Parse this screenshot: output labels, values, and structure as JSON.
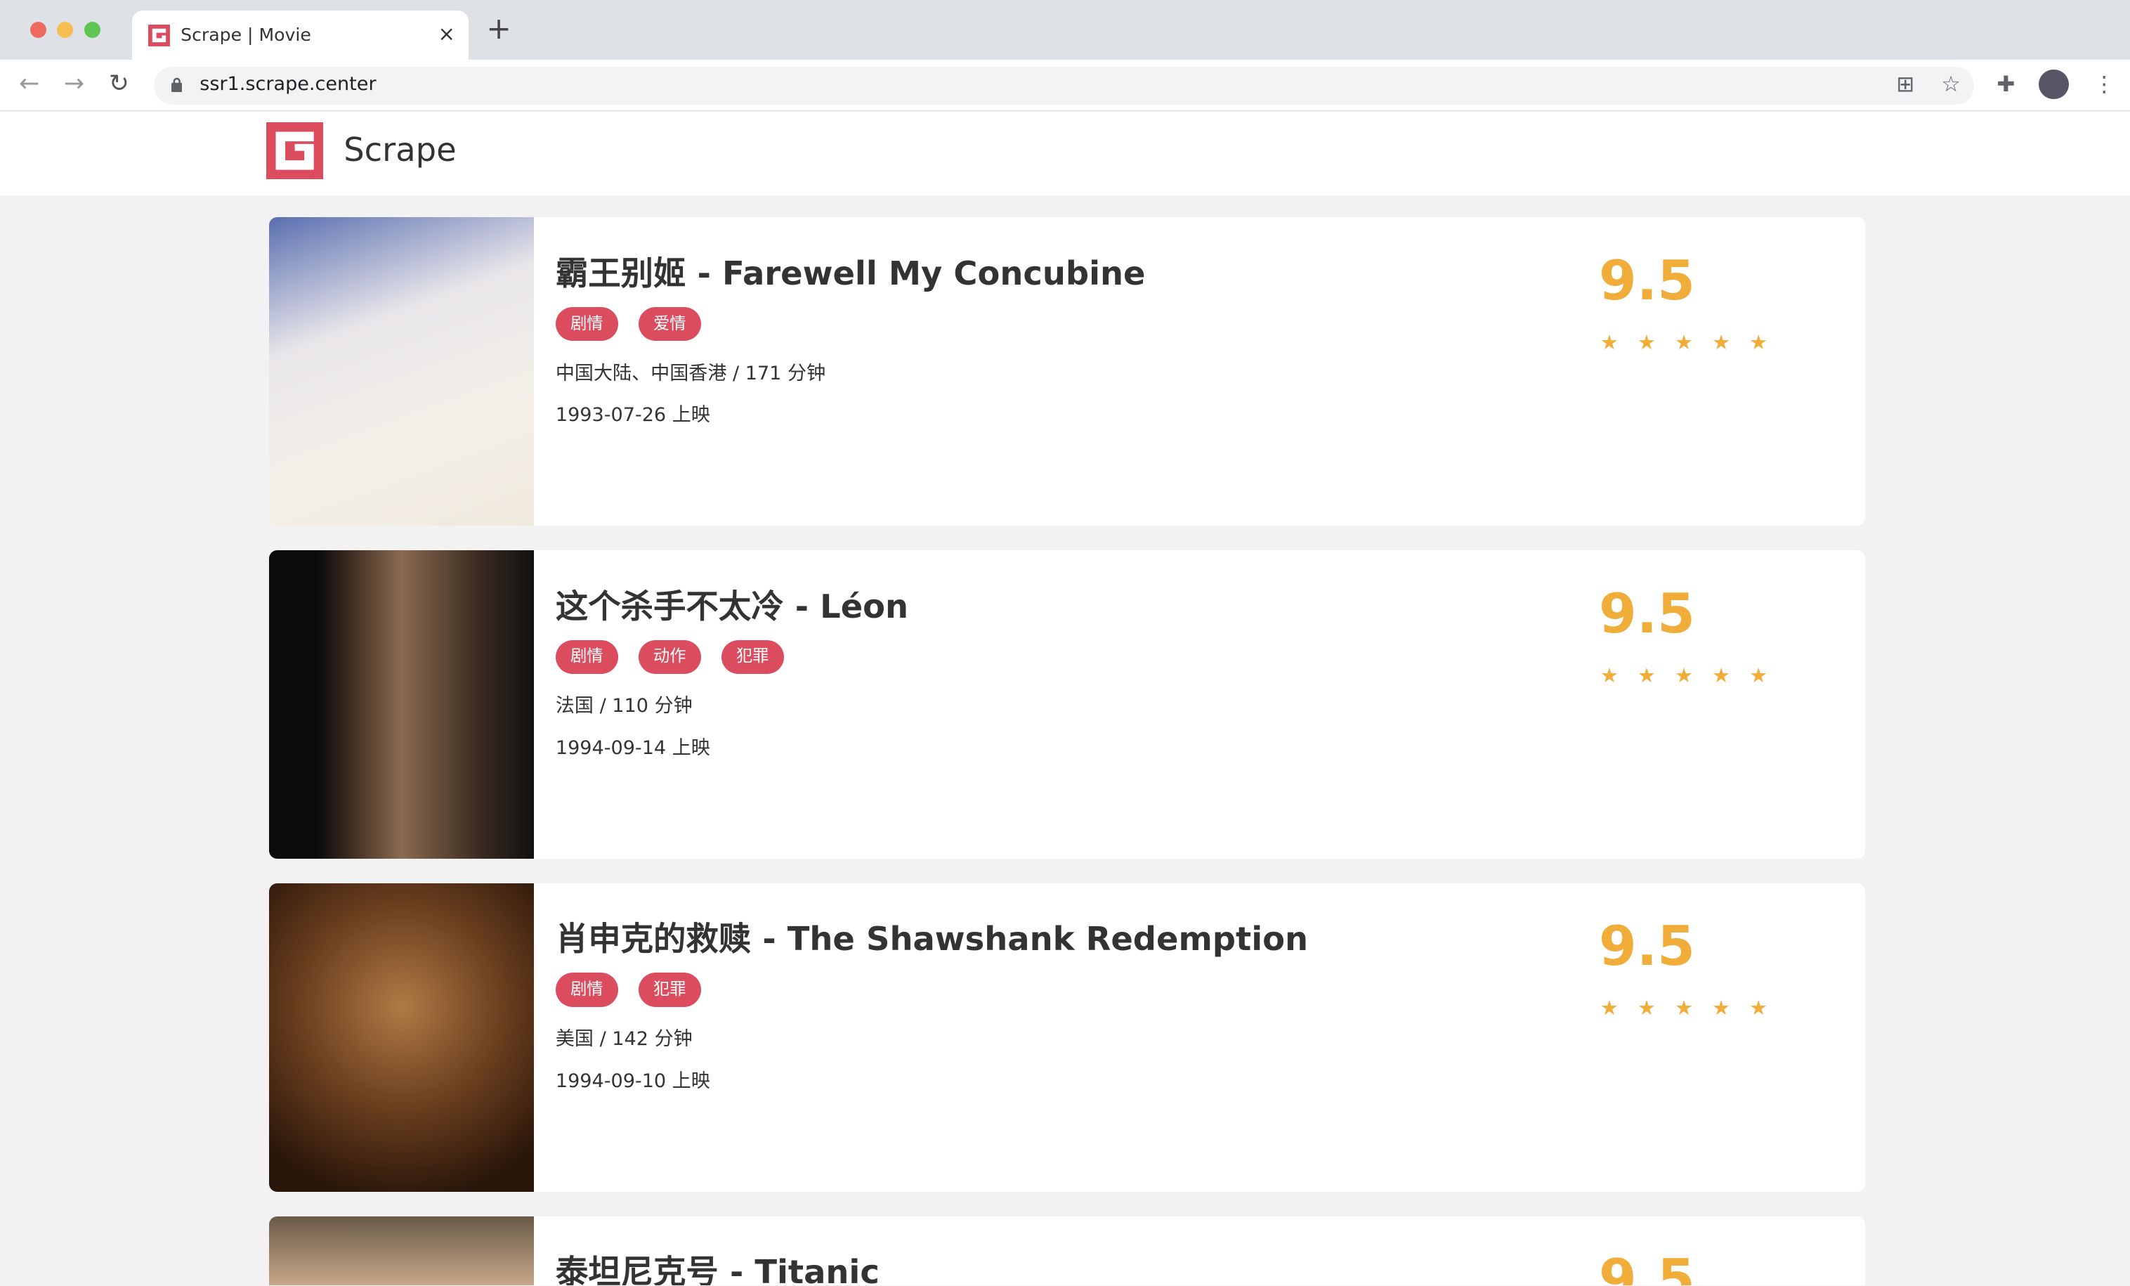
{
  "browser": {
    "tab_title": "Scrape | Movie",
    "url": "ssr1.scrape.center",
    "new_tab": "+",
    "close": "×"
  },
  "site": {
    "brand": "Scrape",
    "accent": "#db4c5f",
    "score_color": "#f0ad3a"
  },
  "movies": [
    {
      "title": "霸王别姬 - Farewell My Concubine",
      "tags": [
        "剧情",
        "爱情"
      ],
      "info": "中国大陆、中国香港 / 171 分钟",
      "release": "1993-07-26 上映",
      "score": "9.5",
      "stars": 5
    },
    {
      "title": "这个杀手不太冷 - Léon",
      "tags": [
        "剧情",
        "动作",
        "犯罪"
      ],
      "info": "法国 / 110 分钟",
      "release": "1994-09-14 上映",
      "score": "9.5",
      "stars": 5
    },
    {
      "title": "肖申克的救赎 - The Shawshank Redemption",
      "tags": [
        "剧情",
        "犯罪"
      ],
      "info": "美国 / 142 分钟",
      "release": "1994-09-10 上映",
      "score": "9.5",
      "stars": 5
    },
    {
      "title": "泰坦尼克号 - Titanic",
      "score": "9.5"
    }
  ]
}
